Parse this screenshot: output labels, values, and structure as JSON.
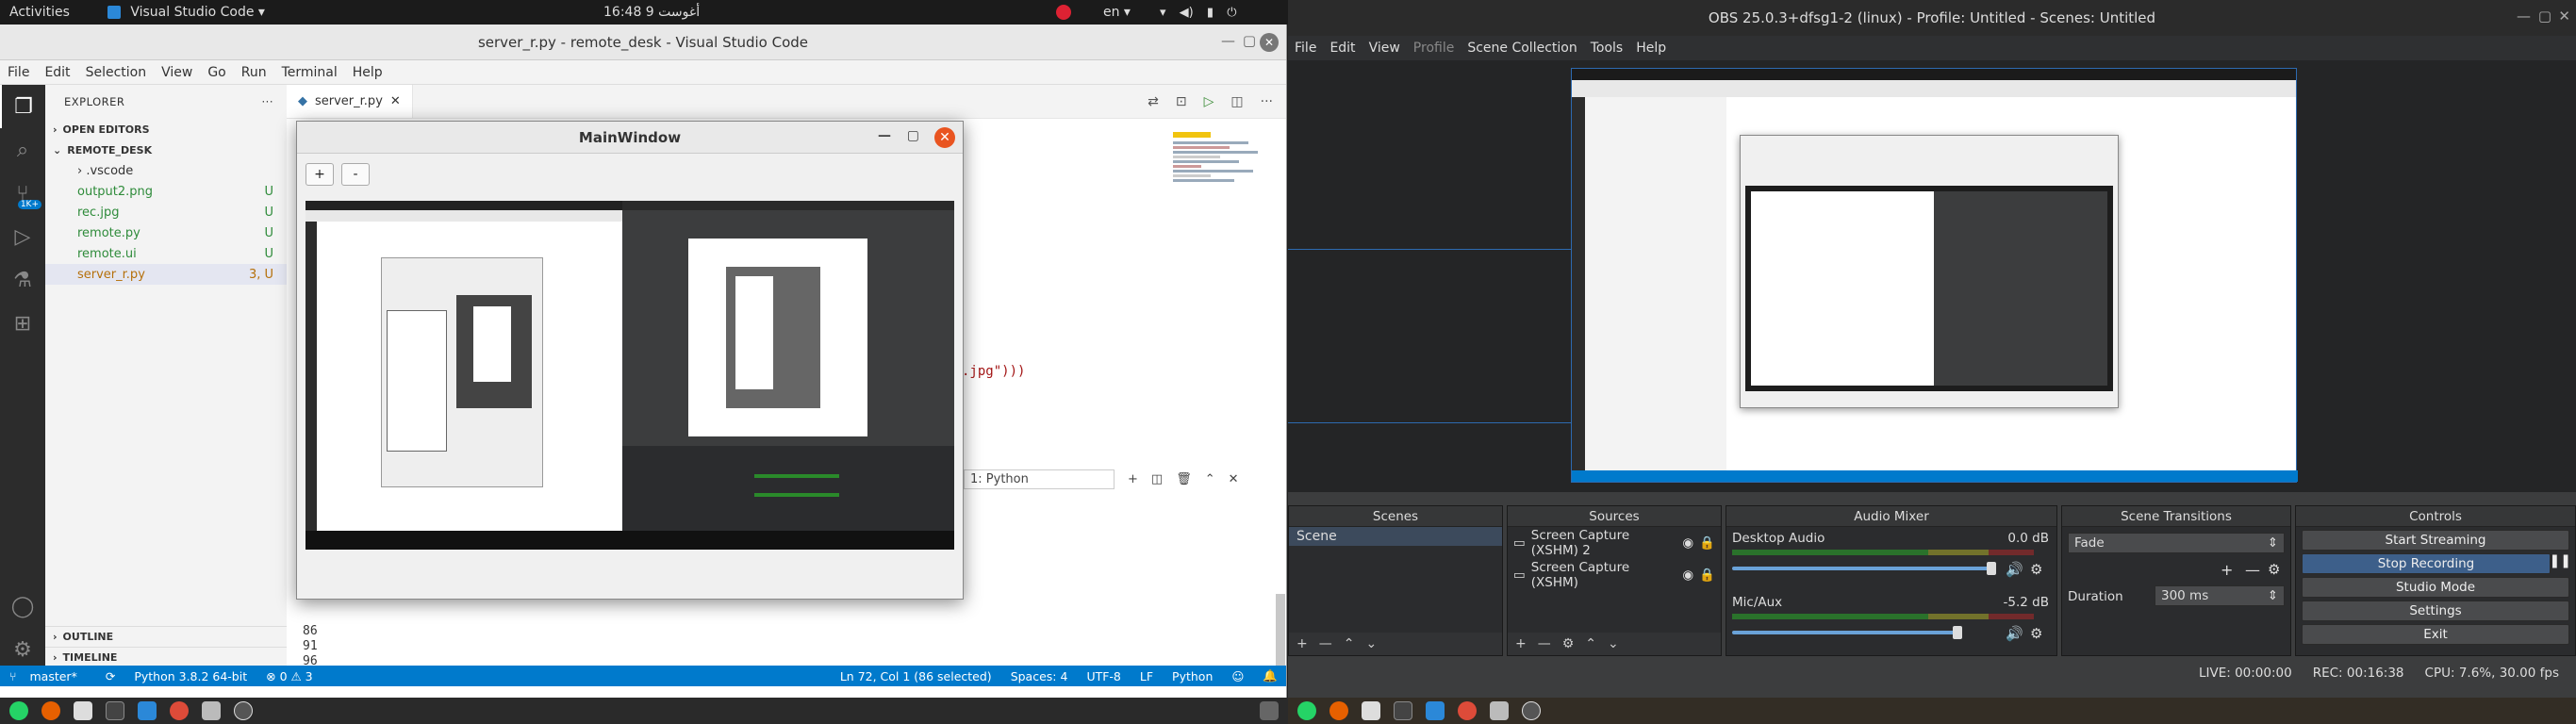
{
  "left_topbar": {
    "activities": "Activities",
    "app_menu": "Visual Studio Code ▾",
    "clock": "16:48 9 أغوست",
    "lang": "en ▾"
  },
  "right_topbar_title": "OBS 25.0.3+dfsg1-2 (linux) - Profile: Untitled - Scenes: Untitled",
  "vscode": {
    "window_title": "server_r.py - remote_desk - Visual Studio Code",
    "menu": [
      "File",
      "Edit",
      "Selection",
      "View",
      "Go",
      "Run",
      "Terminal",
      "Help"
    ],
    "explorer_label": "EXPLORER",
    "explorer_more": "···",
    "open_editors": "OPEN EDITORS",
    "workspace": "REMOTE_DESK",
    "files": [
      {
        "name": "› .vscode",
        "badge": "",
        "style": "plain"
      },
      {
        "name": "output2.png",
        "badge": "U",
        "style": "green"
      },
      {
        "name": "rec.jpg",
        "badge": "U",
        "style": "green"
      },
      {
        "name": "remote.py",
        "badge": "U",
        "style": "green"
      },
      {
        "name": "remote.ui",
        "badge": "U",
        "style": "green"
      },
      {
        "name": "server_r.py",
        "badge": "3, U",
        "style": "sel"
      }
    ],
    "outline": "OUTLINE",
    "timeline": "TIMELINE",
    "tab_name": "server_r.py",
    "code_fragment": ".jpg\")))",
    "terminal_select": "1: Python",
    "line_numbers": [
      "86",
      "91",
      "96"
    ],
    "status": {
      "branch": "master*",
      "python": "Python 3.8.2 64-bit",
      "problems": "⊗ 0 ⚠ 3",
      "position": "Ln 72, Col 1 (86 selected)",
      "spaces": "Spaces: 4",
      "encoding": "UTF-8",
      "eol": "LF",
      "lang": "Python"
    },
    "activity_badge": "1K+"
  },
  "mainwindow": {
    "title": "MainWindow",
    "plus": "+",
    "minus": "-"
  },
  "obs": {
    "menu": [
      {
        "label": "File",
        "dim": false
      },
      {
        "label": "Edit",
        "dim": false
      },
      {
        "label": "View",
        "dim": false
      },
      {
        "label": "Profile",
        "dim": true
      },
      {
        "label": "Scene Collection",
        "dim": false
      },
      {
        "label": "Tools",
        "dim": false
      },
      {
        "label": "Help",
        "dim": false
      }
    ],
    "scenes_title": "Scenes",
    "scene_item": "Scene",
    "sources_title": "Sources",
    "sources": [
      "Screen Capture (XSHM) 2",
      "Screen Capture (XSHM)"
    ],
    "mixer_title": "Audio Mixer",
    "desktop_audio": "Desktop Audio",
    "desktop_db": "0.0 dB",
    "mic_aux": "Mic/Aux",
    "mic_db": "-5.2 dB",
    "transitions_title": "Scene Transitions",
    "transition": "Fade",
    "duration_label": "Duration",
    "duration": "300 ms",
    "controls_title": "Controls",
    "controls": [
      "Start Streaming",
      "Stop Recording",
      "Studio Mode",
      "Settings",
      "Exit"
    ],
    "live": "LIVE: 00:00:00",
    "rec": "REC: 00:16:38",
    "cpu": "CPU: 7.6%, 30.00 fps"
  },
  "colors": {
    "vscode_status": "#007acc",
    "mainwindow_close": "#e95420",
    "obs_bg": "#3c3d3e"
  }
}
